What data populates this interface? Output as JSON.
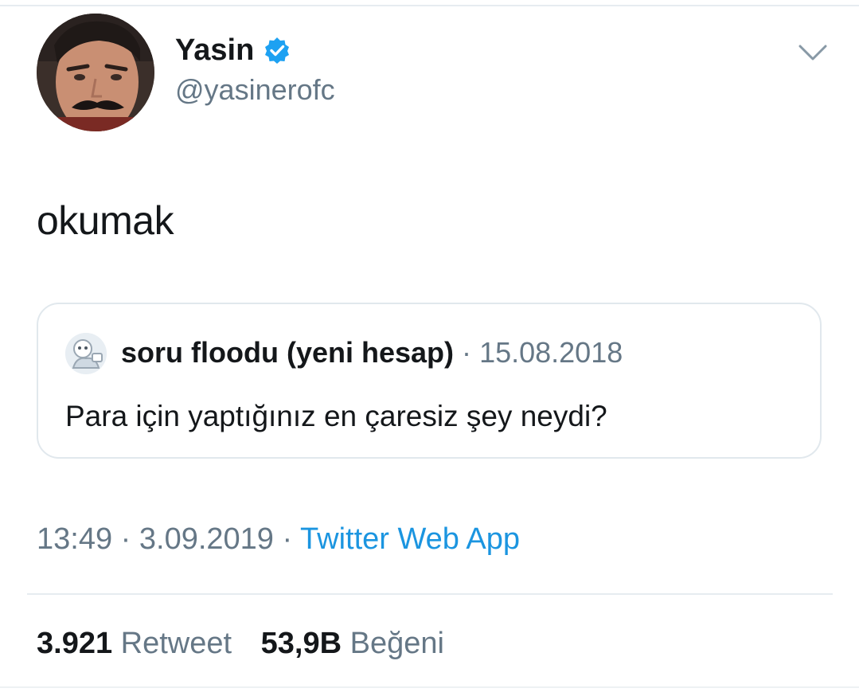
{
  "author": {
    "display_name": "Yasin",
    "handle": "@yasinerofc",
    "verified": true,
    "avatar_icon": "profile-photo-man-with-mustache"
  },
  "menu_icon": "chevron-down-icon",
  "tweet": {
    "text": "okumak"
  },
  "quoted_tweet": {
    "display_name": "soru floodu (yeni hesap)",
    "separator": "·",
    "date": "15.08.2018",
    "text": "Para için yaptığınız en çaresiz şey neydi?",
    "avatar_icon": "cartoon-avatar"
  },
  "meta": {
    "time": "13:49",
    "sep1": "·",
    "date": "3.09.2019",
    "sep2": "·",
    "source": "Twitter Web App"
  },
  "stats": {
    "retweets_count": "3.921",
    "retweets_label": "Retweet",
    "likes_count": "53,9B",
    "likes_label": "Beğeni"
  },
  "colors": {
    "text_primary": "#14171a",
    "text_secondary": "#657786",
    "link": "#1b95e0",
    "verified_badge": "#1da1f2",
    "border": "#e1e8ed"
  }
}
